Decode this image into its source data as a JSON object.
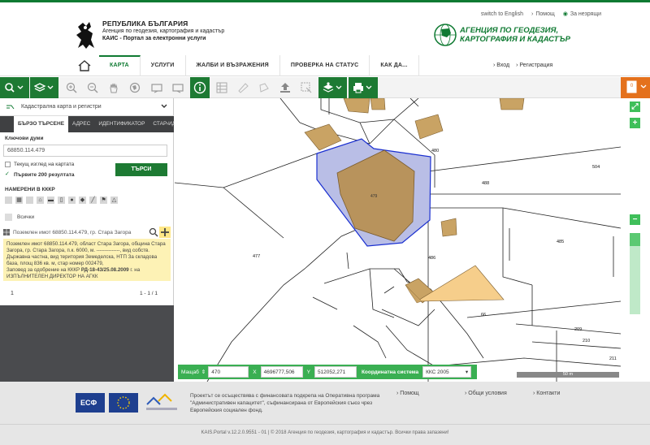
{
  "header": {
    "country": "РЕПУБЛИКА БЪЛГАРИЯ",
    "agency_line": "Агенция по геодезия, картография и кадастър",
    "portal_line": "КАИС - Портал за електронни услуги",
    "agency_logo_line1": "АГЕНЦИЯ ПО ГЕОДЕЗИЯ,",
    "agency_logo_line2": "КАРТОГРАФИЯ И КАДАСТЪР",
    "links": {
      "english": "switch to English",
      "help": "Помощ",
      "visually_impaired": "За незрящи"
    }
  },
  "nav": {
    "items": [
      {
        "label": "КАРТА",
        "active": true
      },
      {
        "label": "УСЛУГИ"
      },
      {
        "label": "ЖАЛБИ И ВЪЗРАЖЕНИЯ"
      },
      {
        "label": "ПРОВЕРКА НА СТАТУС"
      },
      {
        "label": "КАК ДА..."
      }
    ],
    "login": "Вход",
    "register": "Регистрация"
  },
  "toolbar": {
    "badge_count": "0"
  },
  "panel": {
    "layer_select": "Кадастрална карта и регистри",
    "tabs": [
      "БЪРЗО ТЪРСЕНЕ",
      "АДРЕС",
      "ИДЕНТИФИКАТОР",
      "СТАР ИДЕН"
    ],
    "keywords_label": "Ключови думи",
    "keywords_value": "68850.114.479",
    "current_view_label": "Текущ изглед на картата",
    "first200_label": "Първите 200 резултата",
    "search_button": "ТЪРСИ",
    "found_title": "НАМЕРЕНИ В КККР",
    "all_label": "Всички",
    "result_title": "Поземлен имот 68850.114.479, гр. Стара Загора",
    "result_text_1": "Поземлен имот 68850.114.479, област Стара Загора, община Стара Загора, гр. Стара Загора, п.к. 6000, м. --------------, вид собств. Държавна частна, вид територия Земеделска, НТП За складова база, площ 836 кв. м, стар номер 002479,",
    "result_text_2": "Заповед за одобрение на КККР",
    "result_text_3": "РД-18-43/25.08.2009",
    "result_text_4": "г. на ИЗПЪЛНИТЕЛЕН ДИРЕКТОР НА АГКК",
    "pager_page": "1",
    "pager_range": "1 - 1 / 1"
  },
  "map": {
    "labels": [
      "479",
      "480",
      "488",
      "504",
      "485",
      "477",
      "486",
      "66",
      "209",
      "210",
      "211"
    ]
  },
  "coordbar": {
    "scale_label": "Мащаб",
    "scale_value": "470",
    "x_label": "X",
    "x_value": "4696777,506",
    "y_label": "Y",
    "y_value": "512052,271",
    "system_label": "Координатна система",
    "system_value": "ККС 2005",
    "scalebar": "50 m"
  },
  "footer": {
    "text": "Проектът се осъществява с финансовата подкрепа на Оперативна програма \"Административен капацитет\", съфинансирана от Европейския съюз чрез Европейския социален фонд.",
    "links": [
      "Помощ",
      "Общи условия",
      "Контакти"
    ],
    "copyright": "KAIS.Portal v.12.2.0.9551 - 01 | © 2018 Агенция по геодезия, картография и кадастър. Всички права запазени!"
  }
}
